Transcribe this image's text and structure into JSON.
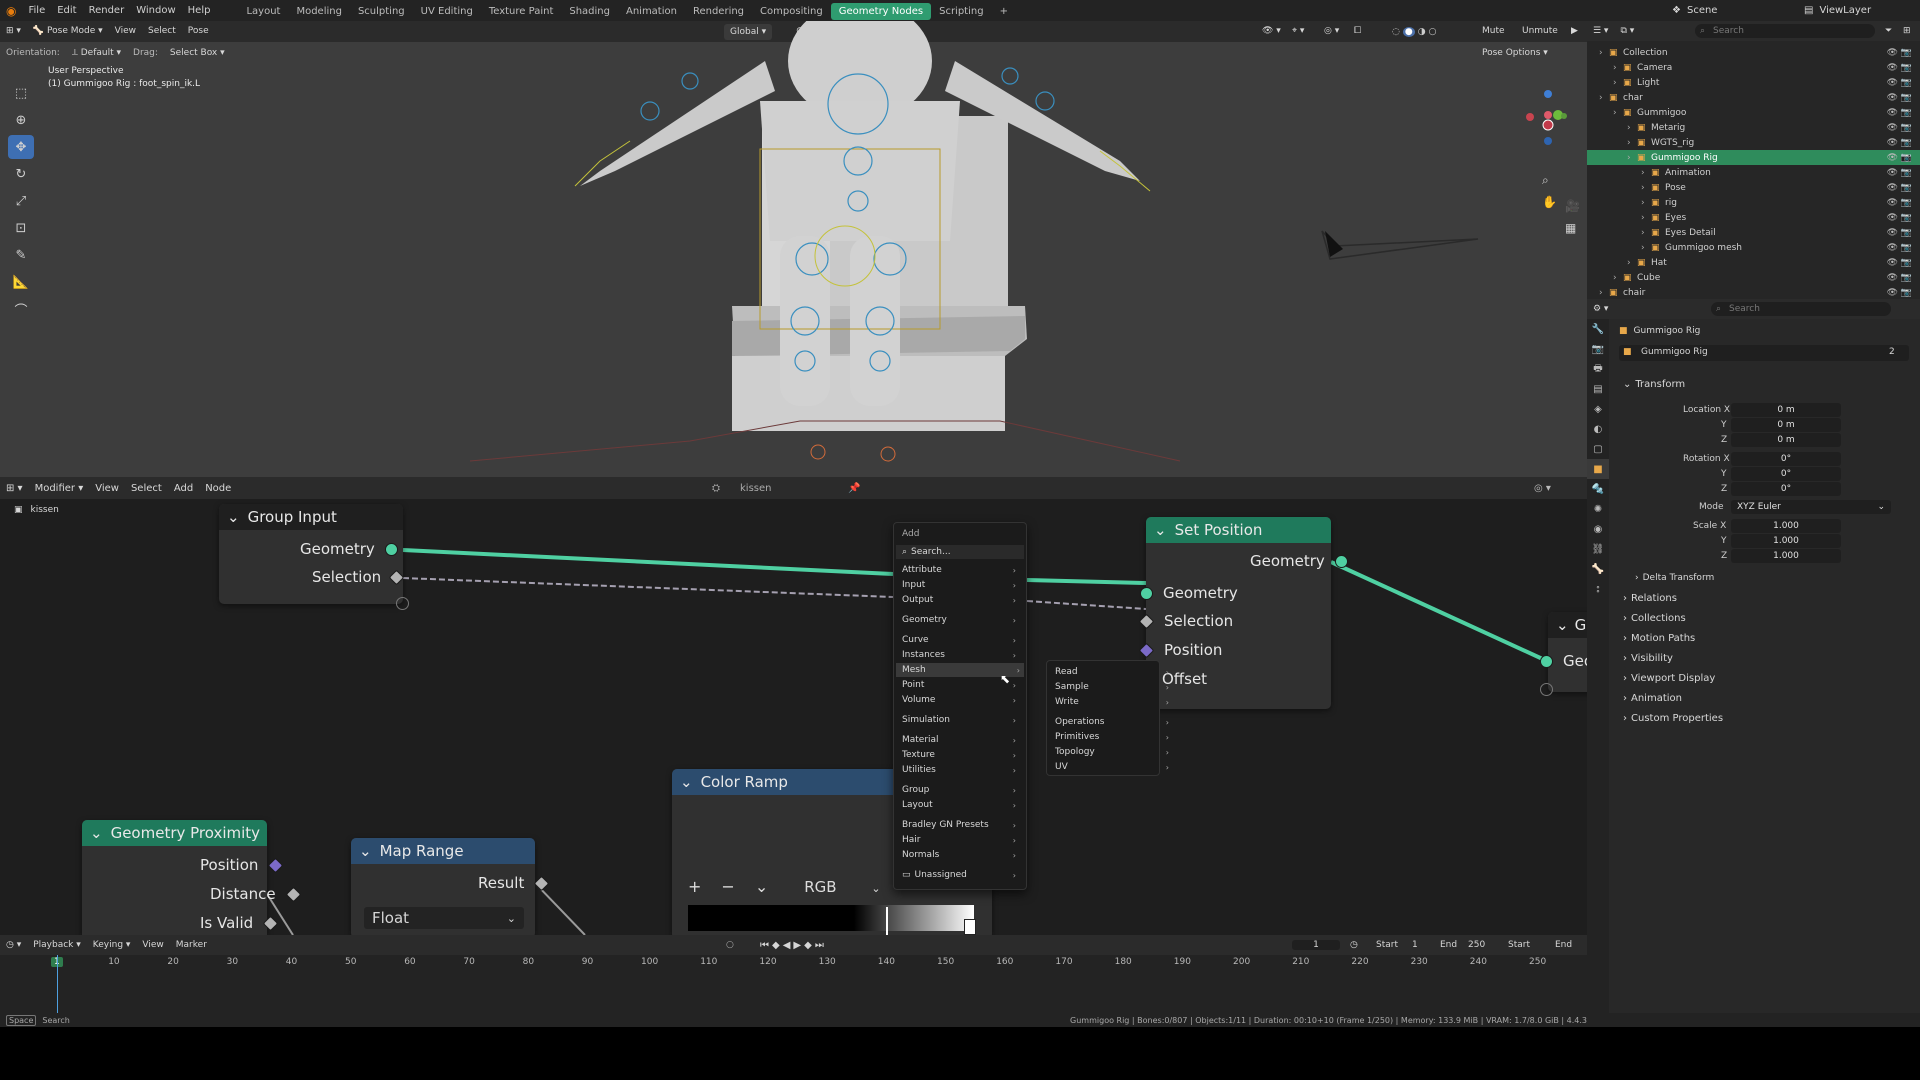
{
  "topbar": {
    "menus": [
      "File",
      "Edit",
      "Render",
      "Window",
      "Help"
    ],
    "workspaces": [
      "Layout",
      "Modeling",
      "Sculpting",
      "UV Editing",
      "Texture Paint",
      "Shading",
      "Animation",
      "Rendering",
      "Compositing",
      "Geometry Nodes",
      "Scripting"
    ],
    "active_workspace": "Geometry Nodes",
    "scene": "Scene",
    "view_layer": "ViewLayer"
  },
  "viewport": {
    "mode": "Pose Mode",
    "menus": [
      "View",
      "Select",
      "Pose"
    ],
    "orientation_label": "Orientation:",
    "orientation": "Default",
    "drag_label": "Drag:",
    "drag": "Select Box",
    "transform": "Global",
    "mute": "Mute",
    "unmute": "Unmute",
    "pose_options": "Pose Options",
    "perspective": "User Perspective",
    "active_bone": "(1) Gummigoo Rig : foot_spin_ik.L"
  },
  "node_editor": {
    "editor_type": "Modifier",
    "menus": [
      "View",
      "Select",
      "Add",
      "Node"
    ],
    "node_tree": "kissen",
    "breadcrumb": "kissen",
    "nodes": {
      "group_input": {
        "title": "Group Input",
        "out": [
          "Geometry",
          "Selection"
        ]
      },
      "set_position": {
        "title": "Set Position",
        "out": "Geometry",
        "in": [
          "Geometry",
          "Selection",
          "Position",
          "Offset"
        ]
      },
      "geometry_proximity": {
        "title": "Geometry Proximity",
        "out": [
          "Position",
          "Distance",
          "Is Valid"
        ]
      },
      "map_range": {
        "title": "Map Range",
        "out": "Result",
        "type": "Float"
      },
      "color_ramp": {
        "title": "Color Ramp",
        "mode": "RGB"
      },
      "group_output": {
        "title": "G",
        "in": "Geo"
      }
    }
  },
  "add_menu": {
    "title": "Add",
    "search": "Search...",
    "items": [
      "Attribute",
      "Input",
      "Output",
      "Geometry",
      "Curve",
      "Instances",
      "Mesh",
      "Point",
      "Volume",
      "Simulation",
      "Material",
      "Texture",
      "Utilities",
      "Group",
      "Layout",
      "Bradley GN Presets",
      "Hair",
      "Normals",
      "Unassigned"
    ],
    "highlighted": "Mesh",
    "submenu": [
      "Read",
      "Sample",
      "Write",
      "Operations",
      "Primitives",
      "Topology",
      "UV"
    ]
  },
  "timeline": {
    "menus": [
      "Playback",
      "Keying",
      "View",
      "Marker"
    ],
    "current_frame": "1",
    "start_label": "Start",
    "start": "1",
    "end_label": "End",
    "end": "250",
    "start2": "Start",
    "end2": "End",
    "ruler": [
      "1",
      "10",
      "20",
      "30",
      "40",
      "50",
      "60",
      "70",
      "80",
      "90",
      "100",
      "110",
      "120",
      "130",
      "140",
      "150",
      "160",
      "170",
      "180",
      "190",
      "200",
      "210",
      "220",
      "230",
      "240",
      "250"
    ]
  },
  "status": {
    "key": "Space",
    "action": "Search",
    "info": "Gummigoo Rig | Bones:0/807 | Objects:1/11 | Duration: 00:10+10 (Frame 1/250) | Memory: 133.9 MiB | VRAM: 1.7/8.0 GiB | 4.4.3"
  },
  "outliner": {
    "search_placeholder": "Search",
    "rows": [
      {
        "label": "Collection",
        "indent": 1
      },
      {
        "label": "Camera",
        "indent": 2
      },
      {
        "label": "Light",
        "indent": 2
      },
      {
        "label": "char",
        "indent": 1
      },
      {
        "label": "Gummigoo",
        "indent": 2
      },
      {
        "label": "Metarig",
        "indent": 3
      },
      {
        "label": "WGTS_rig",
        "indent": 3
      },
      {
        "label": "Gummigoo Rig",
        "indent": 3
      },
      {
        "label": "Animation",
        "indent": 4
      },
      {
        "label": "Pose",
        "indent": 4
      },
      {
        "label": "rig",
        "indent": 4
      },
      {
        "label": "Eyes",
        "indent": 4
      },
      {
        "label": "Eyes Detail",
        "indent": 4
      },
      {
        "label": "Gummigoo mesh",
        "indent": 4
      },
      {
        "label": "Hat",
        "indent": 3
      },
      {
        "label": "Cube",
        "indent": 2
      },
      {
        "label": "chair",
        "indent": 1
      }
    ],
    "selected": "Gummigoo Rig"
  },
  "properties": {
    "search_placeholder": "Search",
    "object_name": "Gummigoo Rig",
    "data_name": "Gummigoo Rig",
    "users": "2",
    "transform_header": "Transform",
    "location_x_label": "Location X",
    "location_x": "0 m",
    "location_y": "0 m",
    "location_z": "0 m",
    "rotation_x_label": "Rotation X",
    "rotation_x": "0°",
    "rotation_y": "0°",
    "rotation_z": "0°",
    "y_label": "Y",
    "z_label": "Z",
    "mode_label": "Mode",
    "mode": "XYZ Euler",
    "scale_x_label": "Scale X",
    "scale_x": "1.000",
    "scale_y": "1.000",
    "scale_z": "1.000",
    "delta_transform": "Delta Transform",
    "sections": [
      "Relations",
      "Collections",
      "Motion Paths",
      "Visibility",
      "Viewport Display",
      "Animation",
      "Custom Properties"
    ]
  },
  "colors": {
    "accent_green": "#2f9c70",
    "geometry_socket": "#4fd0a2",
    "selected_row": "#2f8c5c"
  }
}
